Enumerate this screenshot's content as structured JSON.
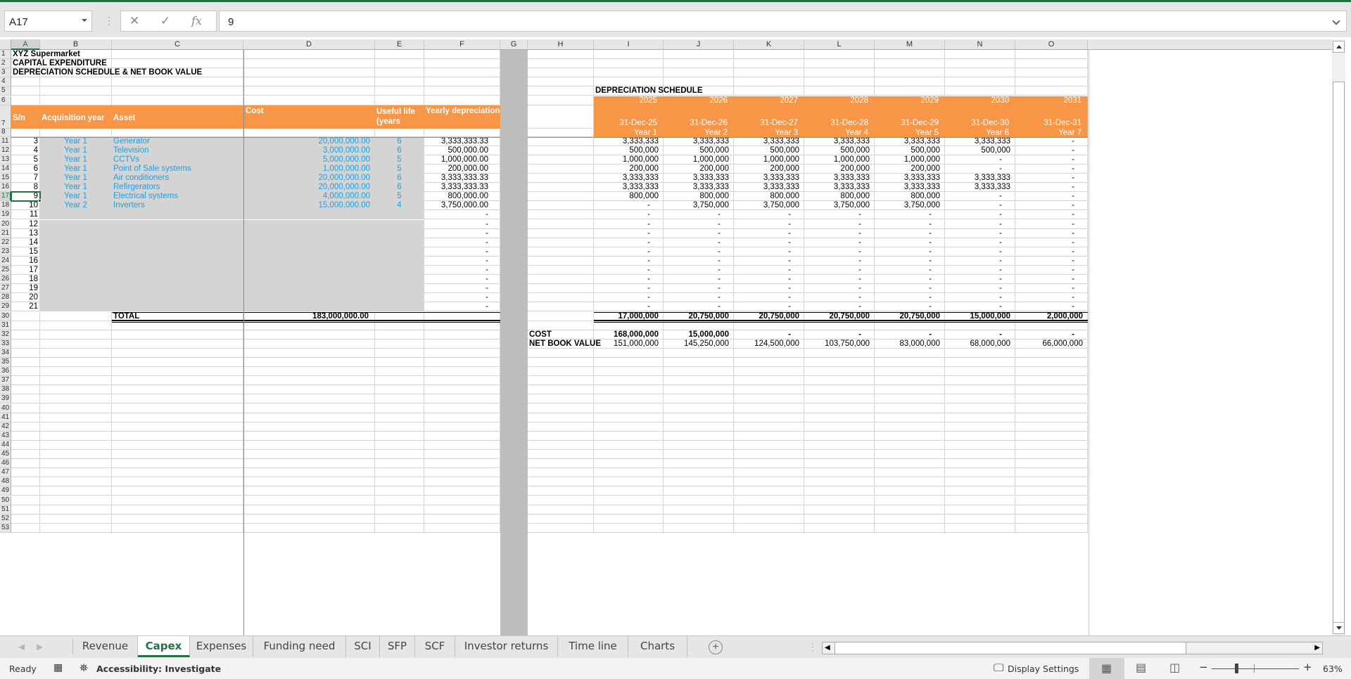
{
  "app": {
    "name_box": "A17",
    "formula_value": "9",
    "accent": "#217346"
  },
  "formula_bar": {
    "cancel_icon": "✕",
    "enter_icon": "✓",
    "fx_label": "fx"
  },
  "columns": [
    "A",
    "B",
    "C",
    "D",
    "E",
    "F",
    "G",
    "H",
    "I",
    "J",
    "K",
    "L",
    "M",
    "N",
    "O"
  ],
  "rows": [
    "1",
    "2",
    "3",
    "4",
    "5",
    "6",
    "7",
    "8",
    "11",
    "12",
    "13",
    "14",
    "15",
    "16",
    "17",
    "18",
    "19",
    "20",
    "21",
    "22",
    "23",
    "24",
    "25",
    "26",
    "27",
    "28",
    "29",
    "30",
    "31",
    "32",
    "33",
    "34",
    "35",
    "36",
    "37",
    "38",
    "39",
    "40",
    "41",
    "42",
    "43",
    "44",
    "45",
    "46",
    "47",
    "48",
    "49",
    "50",
    "51",
    "52",
    "53"
  ],
  "titles": {
    "t1": "XYZ  Supermarket",
    "t2": "CAPITAL EXPENDITURE",
    "t3": "DEPRECIATION SCHEDULE & NET BOOK VALUE"
  },
  "capex_table": {
    "headers": {
      "sn": "S/n",
      "acq": "Acquisition year",
      "asset": "Asset",
      "cost": "Cost",
      "life": "Useful life (years",
      "yearly": "Yearly depreciation"
    },
    "rows": [
      {
        "sn": "3",
        "acq": "Year 1",
        "asset": "Generator",
        "cost": "20,000,000.00",
        "life": "6",
        "yearly": "3,333,333.33"
      },
      {
        "sn": "4",
        "acq": "Year 1",
        "asset": "Television",
        "cost": "3,000,000.00",
        "life": "6",
        "yearly": "500,000.00"
      },
      {
        "sn": "5",
        "acq": "Year 1",
        "asset": "CCTVs",
        "cost": "5,000,000.00",
        "life": "5",
        "yearly": "1,000,000.00"
      },
      {
        "sn": "6",
        "acq": "Year 1",
        "asset": "Point of Sale systems",
        "cost": "1,000,000.00",
        "life": "5",
        "yearly": "200,000.00"
      },
      {
        "sn": "7",
        "acq": "Year 1",
        "asset": "Air conditioners",
        "cost": "20,000,000.00",
        "life": "6",
        "yearly": "3,333,333.33"
      },
      {
        "sn": "8",
        "acq": "Year 1",
        "asset": "Refirgerators",
        "cost": "20,000,000.00",
        "life": "6",
        "yearly": "3,333,333.33"
      },
      {
        "sn": "9",
        "acq": "Year 1",
        "asset": "Electrical systems",
        "cost": "4,000,000.00",
        "life": "5",
        "yearly": "800,000.00"
      },
      {
        "sn": "10",
        "acq": "Year 2",
        "asset": "Inverters",
        "cost": "15,000,000.00",
        "life": "4",
        "yearly": "3,750,000.00"
      },
      {
        "sn": "11",
        "acq": "",
        "asset": "",
        "cost": "",
        "life": "",
        "yearly": "-"
      },
      {
        "sn": "12",
        "acq": "",
        "asset": "",
        "cost": "",
        "life": "",
        "yearly": "-"
      },
      {
        "sn": "13",
        "acq": "",
        "asset": "",
        "cost": "",
        "life": "",
        "yearly": "-"
      },
      {
        "sn": "14",
        "acq": "",
        "asset": "",
        "cost": "",
        "life": "",
        "yearly": "-"
      },
      {
        "sn": "15",
        "acq": "",
        "asset": "",
        "cost": "",
        "life": "",
        "yearly": "-"
      },
      {
        "sn": "16",
        "acq": "",
        "asset": "",
        "cost": "",
        "life": "",
        "yearly": "-"
      },
      {
        "sn": "17",
        "acq": "",
        "asset": "",
        "cost": "",
        "life": "",
        "yearly": "-"
      },
      {
        "sn": "18",
        "acq": "",
        "asset": "",
        "cost": "",
        "life": "",
        "yearly": "-"
      },
      {
        "sn": "19",
        "acq": "",
        "asset": "",
        "cost": "",
        "life": "",
        "yearly": "-"
      },
      {
        "sn": "20",
        "acq": "",
        "asset": "",
        "cost": "",
        "life": "",
        "yearly": "-"
      },
      {
        "sn": "21",
        "acq": "",
        "asset": "",
        "cost": "",
        "life": "",
        "yearly": "-"
      }
    ],
    "total_label": "TOTAL",
    "total_cost": "183,000,000.00"
  },
  "dep_schedule": {
    "title": "DEPRECIATION SCHEDULE",
    "years": [
      "2025",
      "2026",
      "2027",
      "2028",
      "2029",
      "2030",
      "2031"
    ],
    "dates": [
      "31-Dec-25",
      "31-Dec-26",
      "31-Dec-27",
      "31-Dec-28",
      "31-Dec-29",
      "31-Dec-30",
      "31-Dec-31"
    ],
    "periods": [
      "Year 1",
      "Year 2",
      "Year 3",
      "Year 4",
      "Year 5",
      "Year 6",
      "Year 7"
    ],
    "rows": [
      [
        "3,333,333",
        "3,333,333",
        "3,333,333",
        "3,333,333",
        "3,333,333",
        "3,333,333",
        "-"
      ],
      [
        "500,000",
        "500,000",
        "500,000",
        "500,000",
        "500,000",
        "500,000",
        "-"
      ],
      [
        "1,000,000",
        "1,000,000",
        "1,000,000",
        "1,000,000",
        "1,000,000",
        "-",
        "-"
      ],
      [
        "200,000",
        "200,000",
        "200,000",
        "200,000",
        "200,000",
        "-",
        "-"
      ],
      [
        "3,333,333",
        "3,333,333",
        "3,333,333",
        "3,333,333",
        "3,333,333",
        "3,333,333",
        "-"
      ],
      [
        "3,333,333",
        "3,333,333",
        "3,333,333",
        "3,333,333",
        "3,333,333",
        "3,333,333",
        "-"
      ],
      [
        "800,000",
        "800,000",
        "800,000",
        "800,000",
        "800,000",
        "-",
        "-"
      ],
      [
        "-",
        "3,750,000",
        "3,750,000",
        "3,750,000",
        "3,750,000",
        "-",
        "-"
      ],
      [
        "-",
        "-",
        "-",
        "-",
        "-",
        "-",
        "-"
      ],
      [
        "-",
        "-",
        "-",
        "-",
        "-",
        "-",
        "-"
      ],
      [
        "-",
        "-",
        "-",
        "-",
        "-",
        "-",
        "-"
      ],
      [
        "-",
        "-",
        "-",
        "-",
        "-",
        "-",
        "-"
      ],
      [
        "-",
        "-",
        "-",
        "-",
        "-",
        "-",
        "-"
      ],
      [
        "-",
        "-",
        "-",
        "-",
        "-",
        "-",
        "-"
      ],
      [
        "-",
        "-",
        "-",
        "-",
        "-",
        "-",
        "-"
      ],
      [
        "-",
        "-",
        "-",
        "-",
        "-",
        "-",
        "-"
      ],
      [
        "-",
        "-",
        "-",
        "-",
        "-",
        "-",
        "-"
      ],
      [
        "-",
        "-",
        "-",
        "-",
        "-",
        "-",
        "-"
      ],
      [
        "-",
        "-",
        "-",
        "-",
        "-",
        "-",
        "-"
      ]
    ],
    "totals": [
      "17,000,000",
      "20,750,000",
      "20,750,000",
      "20,750,000",
      "20,750,000",
      "15,000,000",
      "2,000,000"
    ],
    "cost_label": "COST",
    "cost": [
      "168,000,000",
      "15,000,000",
      "-",
      "-",
      "-",
      "-",
      "-"
    ],
    "nbv_label": "NET BOOK VALUE",
    "nbv": [
      "151,000,000",
      "145,250,000",
      "124,500,000",
      "103,750,000",
      "83,000,000",
      "68,000,000",
      "66,000,000"
    ]
  },
  "sheet_tabs": [
    "Revenue",
    "Capex",
    "Expenses",
    "Funding need",
    "SCI",
    "SFP",
    "SCF",
    "Investor returns",
    "Time line",
    "Charts"
  ],
  "active_tab": "Capex",
  "status": {
    "ready": "Ready",
    "accessibility": "Accessibility: Investigate",
    "display_settings": "Display Settings",
    "zoom": "63%",
    "zoom_level_percent": 63
  }
}
